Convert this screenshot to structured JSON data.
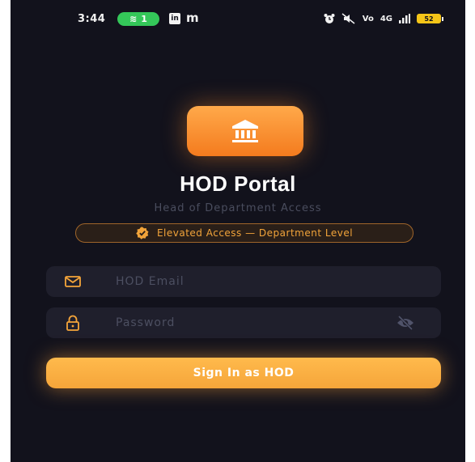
{
  "status_bar": {
    "time": "3:44",
    "hotspot_count": "1",
    "linkedin_label": "in",
    "app_letter": "m",
    "network_label": "Vo",
    "signal_label": "4G",
    "battery": "52"
  },
  "header": {
    "title": "HOD Portal",
    "subtitle": "Head of Department Access"
  },
  "badge": {
    "text": "Elevated Access — Department Level"
  },
  "form": {
    "email_placeholder": "HOD Email",
    "email_value": "",
    "password_placeholder": "Password",
    "password_value": "",
    "submit_label": "Sign In as HOD"
  },
  "colors": {
    "background": "#12121c",
    "accent": "#f5a53a",
    "field_bg": "#1f1f2c",
    "badge_text": "#f2a43a"
  },
  "icons": {
    "logo": "institution-building-icon",
    "badge": "verified-badge-icon",
    "email": "mail-icon",
    "password": "lock-icon",
    "toggle_password": "eye-off-icon"
  }
}
